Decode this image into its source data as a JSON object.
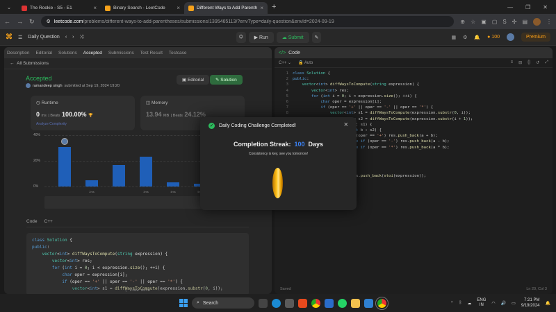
{
  "browser": {
    "tabs": [
      {
        "title": "The Rookie - S5 - E1",
        "active": false
      },
      {
        "title": "Binary Search - LeetCode",
        "active": false
      },
      {
        "title": "Different Ways to Add Parenth",
        "active": true
      }
    ],
    "url_host": "leetcode.com",
    "url_path": "/problems/different-ways-to-add-parentheses/submissions/1395465113/?envType=daily-question&envId=2024-09-19"
  },
  "lc_nav": {
    "daily_label": "Daily Question",
    "run_label": "Run",
    "submit_label": "Submit",
    "coins": "100",
    "premium_label": "Premium"
  },
  "left": {
    "tabs": [
      "Description",
      "Editorial",
      "Solutions",
      "Accepted",
      "Submissions",
      "Test Result",
      "Testcase"
    ],
    "back_label": "All Submissions",
    "status": "Accepted",
    "author": "ramandeep singh",
    "submitted_at": "submitted at Sep 19, 2024 19:20",
    "editorial_btn": "Editorial",
    "solution_btn": "Solution",
    "runtime": {
      "label": "Runtime",
      "value": "0",
      "unit": "ms",
      "beats_label": "| Beats",
      "beats": "100.00%",
      "link": "Analyze Complexity"
    },
    "memory": {
      "label": "Memory",
      "value": "13.94",
      "unit": "MB",
      "beats_label": "| Beats",
      "beats": "24.12%"
    },
    "code_label": "Code",
    "code_lang": "C++",
    "view_more": "View more"
  },
  "chart_data": {
    "type": "bar",
    "y_ticks": [
      "40%",
      "20%",
      "0%"
    ],
    "ylim": [
      0,
      40
    ],
    "categories": [
      "0ms",
      "1ms",
      "2ms",
      "3ms",
      "4ms",
      "5ms",
      "6ms"
    ],
    "x_tick_labels": [
      "",
      "2ms",
      "",
      "3ms",
      "4ms",
      "5ms",
      "6ms"
    ],
    "values": [
      31,
      5,
      17,
      23,
      3,
      2,
      1
    ],
    "highlight_index": 0
  },
  "right": {
    "tab_label": "Code",
    "lang": "C++",
    "mode": "Auto",
    "footer_left": "Saved",
    "footer_right": "Ln 20, Col 3"
  },
  "modal": {
    "title": "Daily Coding Challenge Completed!",
    "streak_label": "Completion Streak:",
    "streak_value": "100",
    "streak_unit": "Days",
    "subtitle": "Consistency is key, see you tomorrow!"
  },
  "taskbar": {
    "search_label": "Search",
    "lang_top": "ENG",
    "lang_bottom": "IN",
    "time": "7:21 PM",
    "date": "9/19/2024"
  }
}
